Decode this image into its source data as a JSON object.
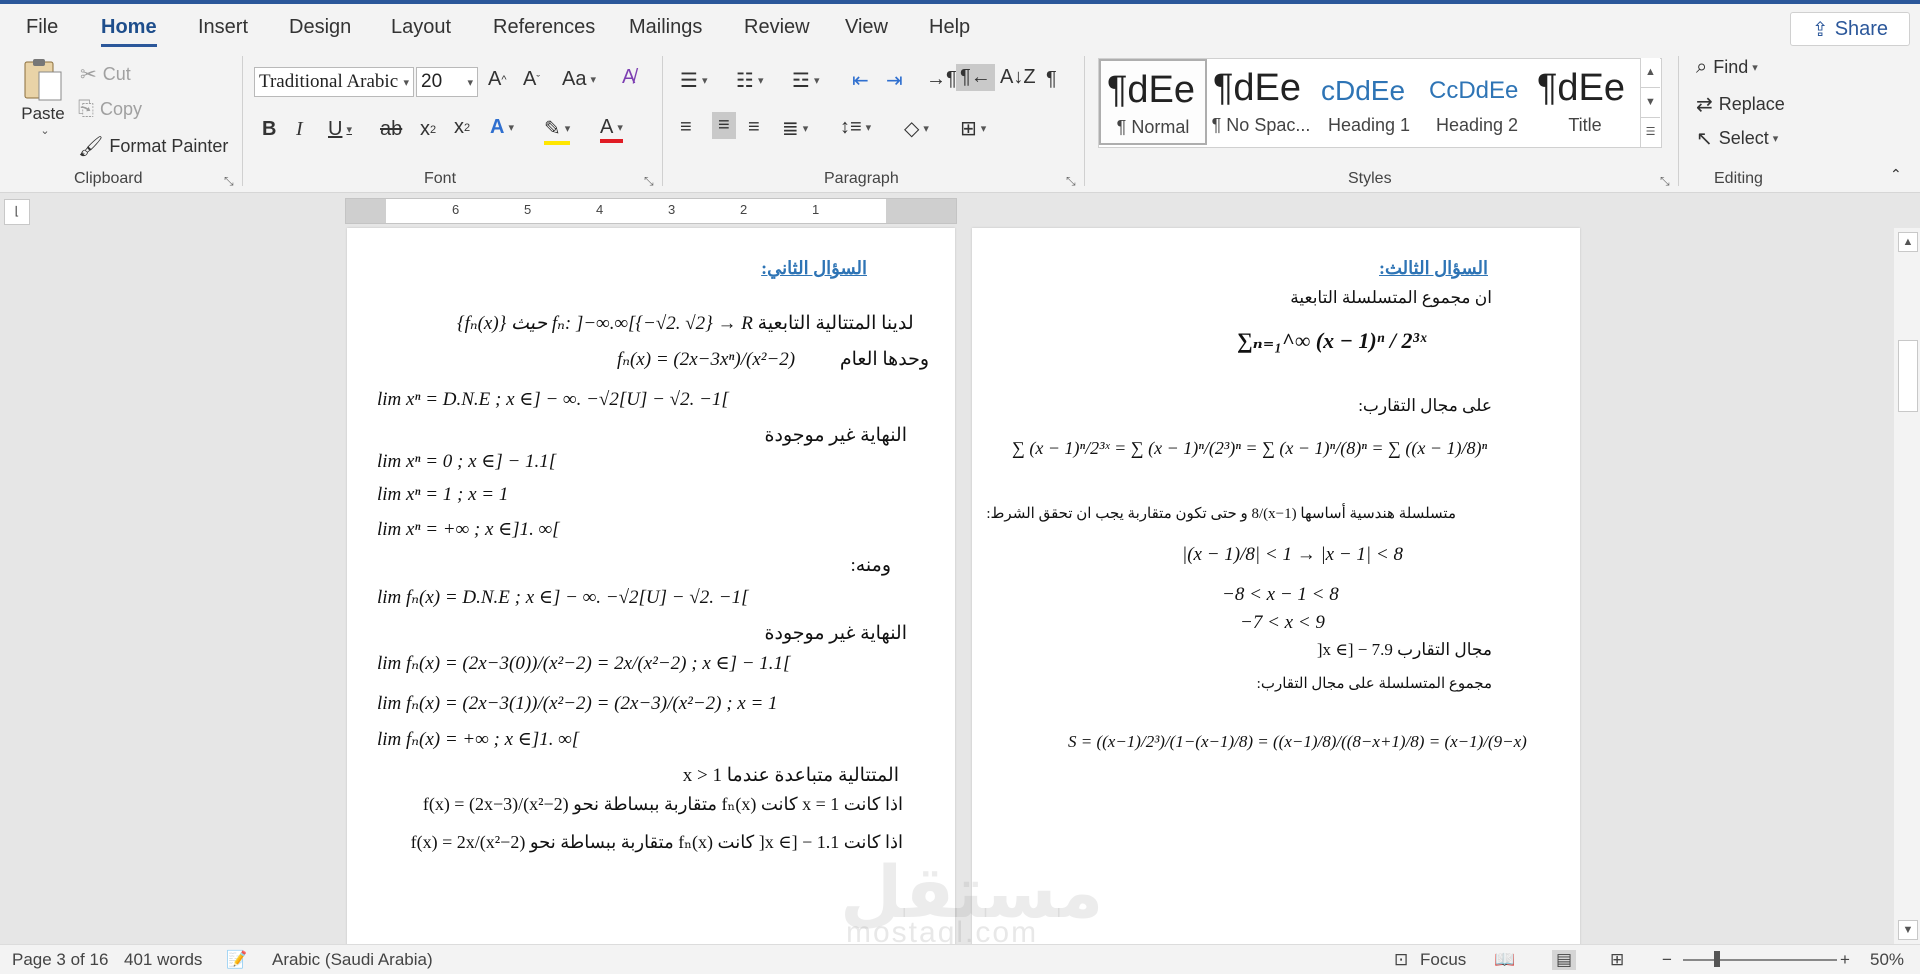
{
  "tabs": [
    "File",
    "Home",
    "Insert",
    "Design",
    "Layout",
    "References",
    "Mailings",
    "Review",
    "View",
    "Help"
  ],
  "active_tab": "Home",
  "share_label": "Share",
  "clipboard": {
    "paste": "Paste",
    "cut": "Cut",
    "copy": "Copy",
    "format_painter": "Format Painter",
    "label": "Clipboard"
  },
  "font": {
    "name": "Traditional Arabic",
    "size": "20",
    "label": "Font"
  },
  "paragraph": {
    "label": "Paragraph"
  },
  "styles": {
    "label": "Styles",
    "items": [
      {
        "sample": "¶dEe",
        "name": "¶ Normal"
      },
      {
        "sample": "¶dEe",
        "name": "¶ No Spac..."
      },
      {
        "sample": "cDdEe",
        "name": "Heading 1"
      },
      {
        "sample": "CcDdEe",
        "name": "Heading 2"
      },
      {
        "sample": "¶dEe",
        "name": "Title"
      }
    ]
  },
  "editing": {
    "find": "Find",
    "replace": "Replace",
    "select": "Select",
    "label": "Editing"
  },
  "ruler_numbers": [
    "6",
    "5",
    "4",
    "3",
    "2",
    "1"
  ],
  "page1": {
    "heading": "السؤال الثاني:",
    "l1_ar": "لدينا المتتالية التابعية",
    "l1_math": "{fₙ(x)} حيث fₙ: ]−∞.∞[{−√2. √2} → R",
    "l2_ar": "وحدها العام",
    "l2_math": "fₙ(x) = (2x−3xⁿ)/(x²−2)",
    "l3": "lim xⁿ = D.N.E        ; x ∈] − ∞. −√2[U] − √2. −1[",
    "l4": "النهاية غير موجودة",
    "l5": "lim xⁿ = 0              ; x ∈] − 1.1[",
    "l6": "lim xⁿ = 1              ; x = 1",
    "l7": "lim xⁿ = +∞            ; x ∈]1. ∞[",
    "l8": "ومنه:",
    "l9": "lim fₙ(x) = D.N.E        ; x ∈] − ∞. −√2[U] − √2. −1[",
    "l10": "النهاية غير موجودة",
    "l11": "lim fₙ(x) = (2x−3(0))/(x²−2) = 2x/(x²−2)      ; x ∈] − 1.1[",
    "l12": "lim fₙ(x) = (2x−3(1))/(x²−2) = (2x−3)/(x²−2)      ; x = 1",
    "l13": "lim fₙ(x) = +∞            ; x ∈]1. ∞[",
    "l14": "المتتالية متباعدة عندما x > 1",
    "l15": "اذا كانت x = 1 كانت fₙ(x) متقاربة ببساطة نحو f(x) = (2x−3)/(x²−2)",
    "l16": "اذا كانت x ∈] − 1.1[ كانت fₙ(x) متقاربة ببساطة نحو f(x) = 2x/(x²−2)"
  },
  "page2": {
    "heading": "السؤال الثالث:",
    "l1": "ان مجموع المتسلسلة التابعية",
    "l2": "∑ₙ₌₁^∞ (x − 1)ⁿ / 2³ˣ",
    "l3": "على مجال التقارب:",
    "l4": "∑ (x − 1)ⁿ/2³ˣ = ∑ (x − 1)ⁿ/(2³)ⁿ = ∑ (x − 1)ⁿ/(8)ⁿ = ∑ ((x − 1)/8)ⁿ",
    "l5": "متسلسلة هندسية أساسها (x−1)/8 و حتى تكون متقاربة يجب ان تحقق الشرط:",
    "l6": "|(x − 1)/8| < 1 → |x − 1| < 8",
    "l7": "−8 < x − 1 < 8",
    "l8": "−7 < x < 9",
    "l9": "مجال التقارب x ∈] − 7.9[",
    "l10": "مجموع المتسلسلة على مجال التقارب:",
    "l11": "S = ((x−1)/2³)/(1−(x−1)/8) = ((x−1)/8)/((8−x+1)/8) = (x−1)/(9−x)"
  },
  "status": {
    "page": "Page 3 of 16",
    "words": "401 words",
    "language": "Arabic (Saudi Arabia)",
    "focus": "Focus",
    "zoom": "50%"
  },
  "watermark": {
    "ar": "مستقل",
    "en": "mostaql.com"
  },
  "colors": {
    "accent": "#2b579a",
    "heading": "#2e74b5"
  }
}
